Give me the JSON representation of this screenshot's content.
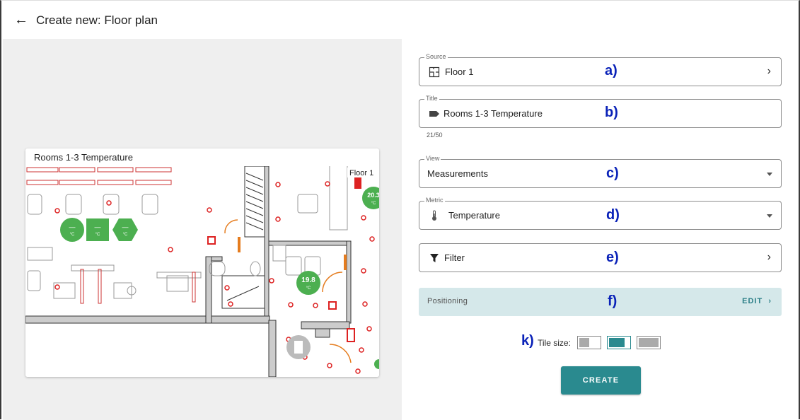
{
  "header": {
    "title": "Create new: Floor plan"
  },
  "preview": {
    "title": "Rooms 1-3 Temperature",
    "floor_label": "Floor 1",
    "sensors": [
      {
        "value": "20.3",
        "unit": "°C"
      },
      {
        "value": "19.8",
        "unit": "°C"
      },
      {
        "value": "—",
        "unit": "°C"
      },
      {
        "value": "—",
        "unit": "°C"
      },
      {
        "value": "—",
        "unit": "°C"
      }
    ]
  },
  "form": {
    "source": {
      "label": "Source",
      "value": "Floor 1",
      "annotation": "a)"
    },
    "title": {
      "label": "Title",
      "value": "Rooms 1-3 Temperature",
      "counter": "21/50",
      "annotation": "b)"
    },
    "view": {
      "label": "View",
      "value": "Measurements",
      "annotation": "c)"
    },
    "metric": {
      "label": "Metric",
      "value": "Temperature",
      "annotation": "d)"
    },
    "filter": {
      "value": "Filter",
      "annotation": "e)"
    },
    "positioning": {
      "label": "Positioning",
      "edit_label": "EDIT",
      "annotation": "f)"
    },
    "tile_size": {
      "label": "Tile size:",
      "annotation": "k)",
      "selected": "medium",
      "options": [
        "small",
        "medium",
        "large"
      ]
    },
    "create_label": "CREATE"
  },
  "colors": {
    "accent": "#2a8a8f",
    "positioning_bg": "#d5e8ea",
    "annotation": "#0a22b8",
    "sensor_green": "#4caf50"
  }
}
